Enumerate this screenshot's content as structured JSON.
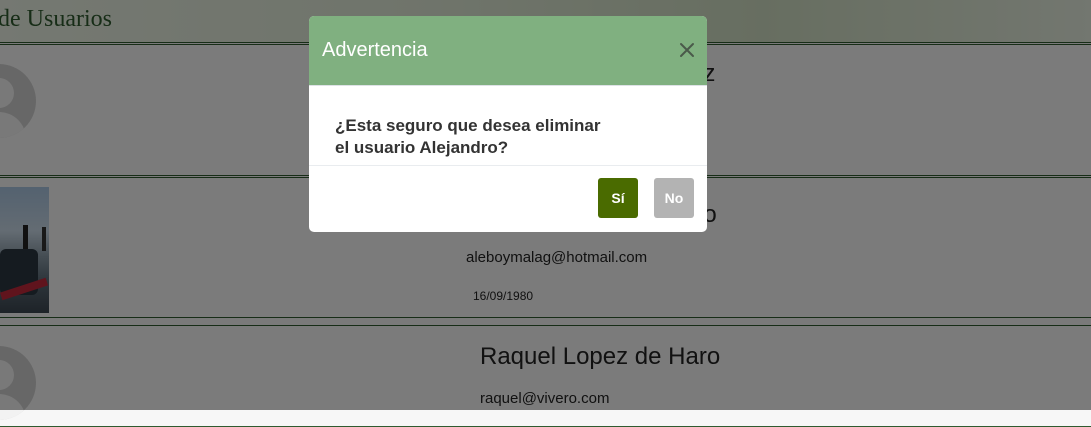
{
  "page": {
    "title": "de Usuarios"
  },
  "users": [
    {
      "name_visible": "az"
    },
    {
      "name_visible": "no",
      "email": "aleboymalag@hotmail.com",
      "birthdate": "16/09/1980"
    },
    {
      "name": "Raquel Lopez de Haro",
      "email": "raquel@vivero.com"
    }
  ],
  "modal": {
    "title": "Advertencia",
    "close_icon": "close-icon",
    "message": "¿Esta seguro que desea eliminar el usuario Alejandro?",
    "confirm_label": "Sí",
    "cancel_label": "No"
  },
  "colors": {
    "modal_header": "#80b080",
    "confirm_button": "#4a6b00",
    "cancel_button": "#b3b3b3",
    "brand_green": "#2f5a2f"
  }
}
